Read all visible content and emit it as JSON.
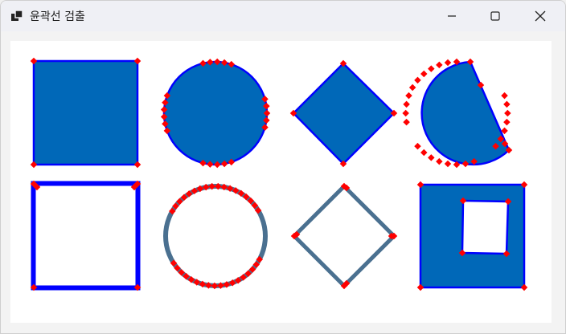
{
  "window": {
    "title": "윤곽선 검출",
    "icon": "app-windows-icon",
    "controls": [
      {
        "name": "minimize",
        "icon": "minimize-icon"
      },
      {
        "name": "maximize",
        "icon": "maximize-icon"
      },
      {
        "name": "close",
        "icon": "close-icon"
      }
    ]
  },
  "colors": {
    "fill": "#0068b8",
    "contour": "#0000ff",
    "point": "#ff0000",
    "outline_gray": "#4a7090",
    "background": "#ffffff"
  },
  "shapes": [
    {
      "name": "filled-square"
    },
    {
      "name": "filled-circle"
    },
    {
      "name": "filled-diamond"
    },
    {
      "name": "filled-cut-circle"
    },
    {
      "name": "outline-square"
    },
    {
      "name": "outline-circle"
    },
    {
      "name": "outline-diamond"
    },
    {
      "name": "square-with-hole"
    }
  ]
}
